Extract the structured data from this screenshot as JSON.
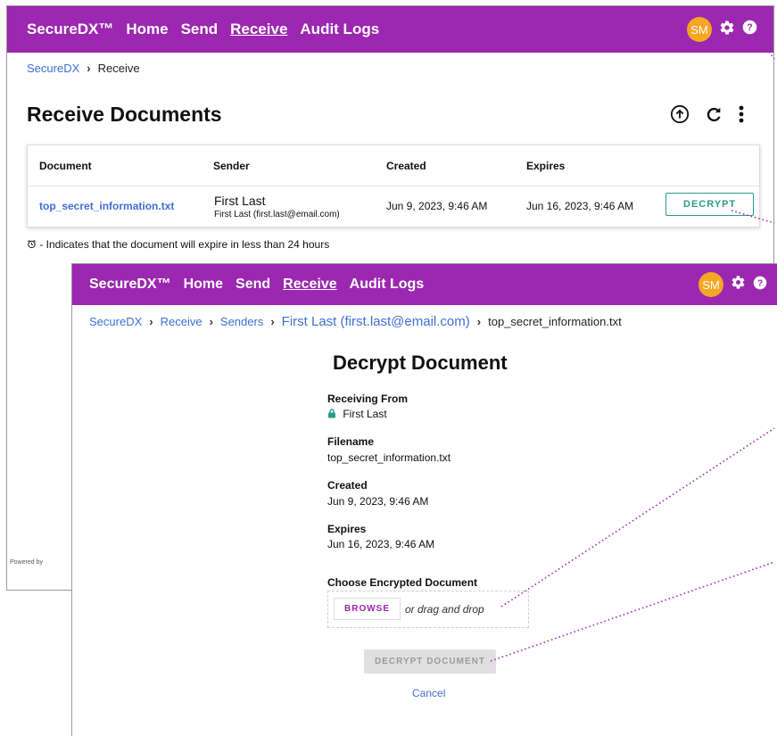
{
  "brand": "SecureDX™",
  "nav": [
    "Home",
    "Send",
    "Receive",
    "Audit Logs"
  ],
  "avatar_initials": "SM",
  "colors": {
    "brand": "#9c27b0",
    "avatar": "#f5a623",
    "link": "#3f6fd4",
    "decrypt_accent": "#2b9a8a"
  },
  "icons": {
    "settings": "gear-icon",
    "help": "help-icon",
    "upload": "upload-icon",
    "refresh": "refresh-icon",
    "more": "more-vert-icon",
    "lock": "lock-icon",
    "alarm": "alarm-clock-icon"
  },
  "receive": {
    "breadcrumb": [
      "SecureDX",
      "Receive"
    ],
    "title": "Receive Documents",
    "columns": [
      "Document",
      "Sender",
      "Created",
      "Expires"
    ],
    "rows": [
      {
        "document": "top_secret_information.txt",
        "sender_name": "First Last",
        "sender_detail": "First Last (first.last@email.com)",
        "created": "Jun 9, 2023, 9:46 AM",
        "expires": "Jun 16, 2023, 9:46 AM",
        "action": "DECRYPT"
      }
    ],
    "note": "- Indicates that the document will expire in less than 24 hours",
    "powered": "Powered by"
  },
  "decrypt": {
    "breadcrumb": [
      "SecureDX",
      "Receive",
      "Senders",
      "First Last (first.last@email.com)",
      "top_secret_information.txt"
    ],
    "title": "Decrypt Document",
    "receiving_from_label": "Receiving From",
    "receiving_from": "First Last",
    "filename_label": "Filename",
    "filename": "top_secret_information.txt",
    "created_label": "Created",
    "created": "Jun 9, 2023, 9:46 AM",
    "expires_label": "Expires",
    "expires": "Jun 16, 2023, 9:46 AM",
    "choose_label": "Choose Encrypted Document",
    "browse": "BROWSE",
    "drag_text": "or drag and drop",
    "decrypt_button": "DECRYPT DOCUMENT",
    "cancel": "Cancel"
  }
}
